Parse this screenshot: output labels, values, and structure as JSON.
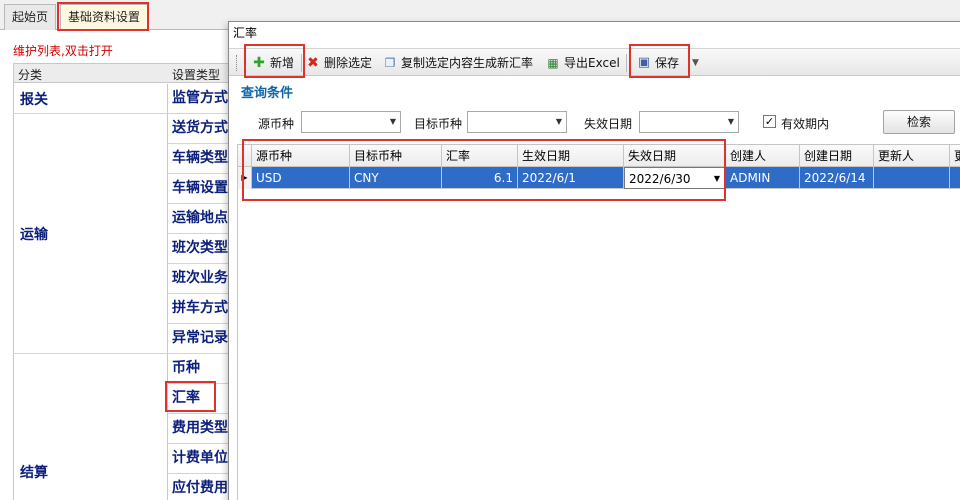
{
  "tabs": [
    {
      "label": "起始页"
    },
    {
      "label": "基础资料设置"
    }
  ],
  "hint_text": "维护列表,双击打开",
  "left_grid": {
    "headers": [
      "分类",
      "设置类型"
    ],
    "categories": [
      "报关",
      "运输",
      "结算"
    ],
    "types": [
      "监管方式",
      "送货方式",
      "车辆类型",
      "车辆设置",
      "运输地点",
      "班次类型",
      "班次业务",
      "拼车方式",
      "异常记录",
      "币种",
      "汇率",
      "费用类型",
      "计费单位",
      "应付费用"
    ]
  },
  "dialog": {
    "title": "汇率",
    "toolbar": {
      "add": "新增",
      "delete": "删除选定",
      "copy": "复制选定内容生成新汇率",
      "export": "导出Excel",
      "save": "保存"
    },
    "section_title": "查询条件",
    "filters": {
      "source_currency": "源币种",
      "target_currency": "目标币种",
      "expire_date": "失效日期",
      "valid_only": "有效期内",
      "search": "检索"
    },
    "grid": {
      "headers": [
        "源币种",
        "目标币种",
        "汇率",
        "生效日期",
        "失效日期",
        "创建人",
        "创建日期",
        "更新人",
        "更"
      ],
      "rows": [
        [
          "USD",
          "CNY",
          "6.1",
          "2022/6/1",
          "2022/6/30",
          "ADMIN",
          "2022/6/14",
          "",
          ""
        ]
      ]
    }
  },
  "colors": {
    "selection": "#2f6cc8",
    "highlight": "#e0322c",
    "hint": "#d00000",
    "nav_text": "#0b1f7c",
    "section": "#0f66a8"
  }
}
